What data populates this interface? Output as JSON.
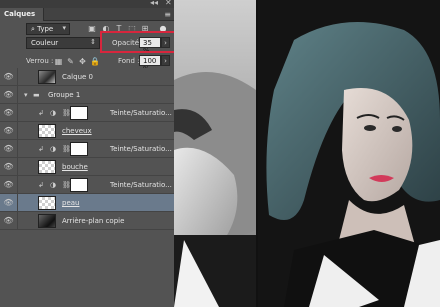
{
  "panel": {
    "title": "Calques",
    "top_controls": [
      "◂◂",
      "✕"
    ],
    "filter": {
      "value": "Type"
    },
    "blend_mode": "Couleur",
    "opacity_label": "Opacité :",
    "opacity_value": "35 %",
    "lock_label": "Verrou :",
    "fill_label": "Fond :",
    "fill_value": "100 %"
  },
  "layers": [
    {
      "name": "Calque 0",
      "type": "photo",
      "clip": false,
      "underline": false,
      "active": false
    },
    {
      "name": "Groupe 1",
      "type": "group",
      "clip": false,
      "underline": false,
      "active": false
    },
    {
      "name": "Teinte/Saturatio...",
      "type": "adjustment",
      "clip": true,
      "underline": false,
      "active": false
    },
    {
      "name": "cheveux",
      "type": "pixel",
      "clip": false,
      "underline": true,
      "active": false
    },
    {
      "name": "Teinte/Saturatio...",
      "type": "adjustment",
      "clip": true,
      "underline": false,
      "active": false
    },
    {
      "name": "bouche",
      "type": "pixel",
      "clip": false,
      "underline": true,
      "active": false
    },
    {
      "name": "Teinte/Saturatio...",
      "type": "adjustment",
      "clip": true,
      "underline": false,
      "active": false
    },
    {
      "name": "peau",
      "type": "pixel",
      "clip": false,
      "underline": true,
      "active": true
    },
    {
      "name": "Arrière-plan copie",
      "type": "photo-dark",
      "clip": false,
      "underline": false,
      "active": false
    }
  ],
  "colors": {
    "panel_bg": "#535353",
    "selected_layer": "#6a7a8c",
    "highlight_box": "#d7263d",
    "lips": "#d23a5a",
    "hair": "#4d6a6f"
  }
}
